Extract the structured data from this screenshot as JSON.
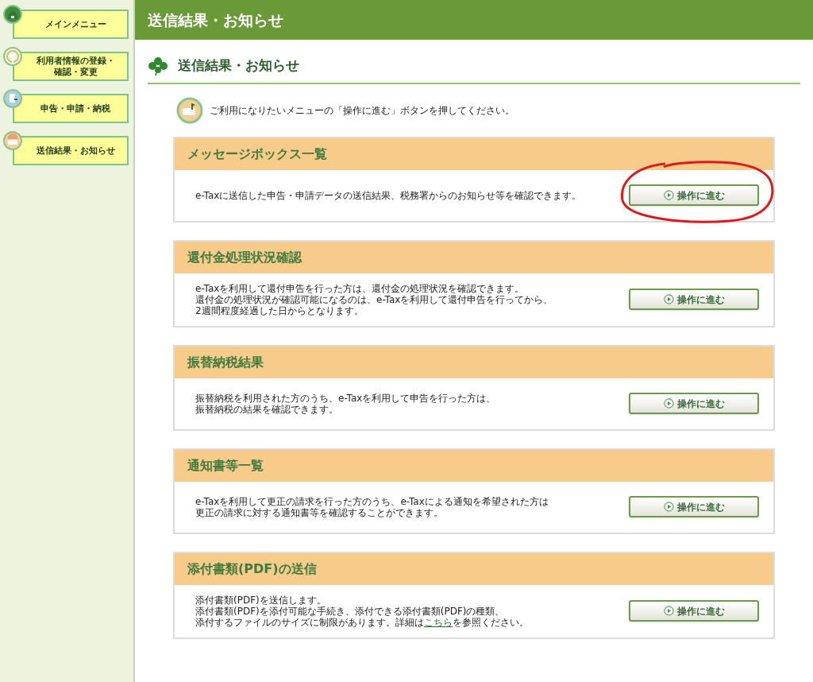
{
  "sidebar": {
    "items": [
      {
        "lines": [
          "メインメニュー"
        ]
      },
      {
        "lines": [
          "利用者情報の登録・",
          "確認・変更"
        ]
      },
      {
        "lines": [
          "申告・申請・納税"
        ]
      },
      {
        "lines": [
          "送信結果・お知らせ"
        ]
      }
    ]
  },
  "header": {
    "title": "送信結果・お知らせ"
  },
  "section": {
    "title": "送信結果・お知らせ"
  },
  "intro": "ご利用になりたいメニューの「操作に進む」ボタンを押してください。",
  "cards": [
    {
      "title": "メッセージボックス一覧",
      "lines": [
        [
          {
            "kind": "text",
            "text": "e-Taxに送信した申告・申請データの送信結果、税務署からのお知らせ等を確認できます。"
          }
        ]
      ],
      "button": "操作に進む",
      "circled": true
    },
    {
      "title": "還付金処理状況確認",
      "lines": [
        [
          {
            "kind": "text",
            "text": "e-Taxを利用して還付申告を行った方は、還付金の処理状況を確認できます。"
          }
        ],
        [
          {
            "kind": "text",
            "text": "還付金の処理状況が確認可能になるのは、e-Taxを利用して還付申告を行ってから、"
          }
        ],
        [
          {
            "kind": "text",
            "text": "2週間程度経過した日からとなります。"
          }
        ]
      ],
      "button": "操作に進む",
      "circled": false
    },
    {
      "title": "振替納税結果",
      "lines": [
        [
          {
            "kind": "text",
            "text": "振替納税を利用された方のうち、e-Taxを利用して申告を行った方は、"
          }
        ],
        [
          {
            "kind": "text",
            "text": "振替納税の結果を確認できます。"
          }
        ]
      ],
      "button": "操作に進む",
      "circled": false
    },
    {
      "title": "通知書等一覧",
      "lines": [
        [
          {
            "kind": "text",
            "text": "e-Taxを利用して更正の請求を行った方のうち、e-Taxによる通知を希望された方は"
          }
        ],
        [
          {
            "kind": "text",
            "text": "更正の請求に対する通知書等を確認することができます。"
          }
        ]
      ],
      "button": "操作に進む",
      "circled": false
    },
    {
      "title": "添付書類(PDF)の送信",
      "lines": [
        [
          {
            "kind": "text",
            "text": "添付書類(PDF)を送信します。"
          }
        ],
        [
          {
            "kind": "text",
            "text": "添付書類(PDF)を添付可能な手続き、添付できる添付書類(PDF)の種類、"
          }
        ],
        [
          {
            "kind": "text",
            "text": "添付するファイルのサイズに制限があります。詳細は"
          },
          {
            "kind": "link",
            "text": "こちら"
          },
          {
            "kind": "text",
            "text": "を参照ください。"
          }
        ]
      ],
      "button": "操作に進む",
      "circled": false
    }
  ]
}
